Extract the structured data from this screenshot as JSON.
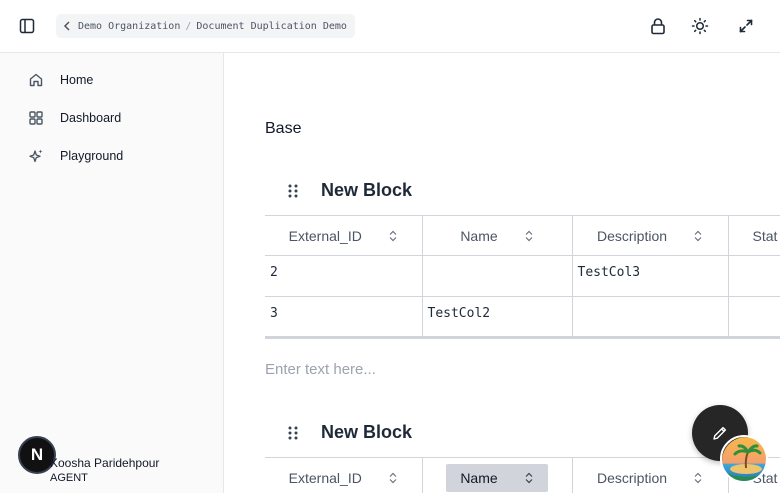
{
  "breadcrumb": {
    "org": "Demo Organization",
    "separator": "/",
    "page": "Document Duplication Demo"
  },
  "sidebar": {
    "items": [
      {
        "label": "Home",
        "icon": "home-icon"
      },
      {
        "label": "Dashboard",
        "icon": "dashboard-icon"
      },
      {
        "label": "Playground",
        "icon": "sparkle-icon"
      }
    ],
    "user": {
      "initial": "N",
      "name": "Koosha Paridehpour",
      "role": "AGENT"
    }
  },
  "main": {
    "base_label": "Base",
    "blocks": [
      {
        "title": "New Block",
        "columns": [
          "External_ID",
          "Name",
          "Description",
          "Stat"
        ],
        "rows": [
          [
            "2",
            "",
            "TestCol3",
            ""
          ],
          [
            "3",
            "TestCol2",
            "",
            ""
          ]
        ]
      },
      {
        "title": "New Block",
        "columns": [
          "External_ID",
          "Name",
          "Description",
          "Stat"
        ]
      }
    ],
    "text_placeholder": "Enter text here..."
  },
  "colors": {
    "fab": "#262626",
    "border": "#d1d5db",
    "selected_header": "#d1d5db"
  }
}
